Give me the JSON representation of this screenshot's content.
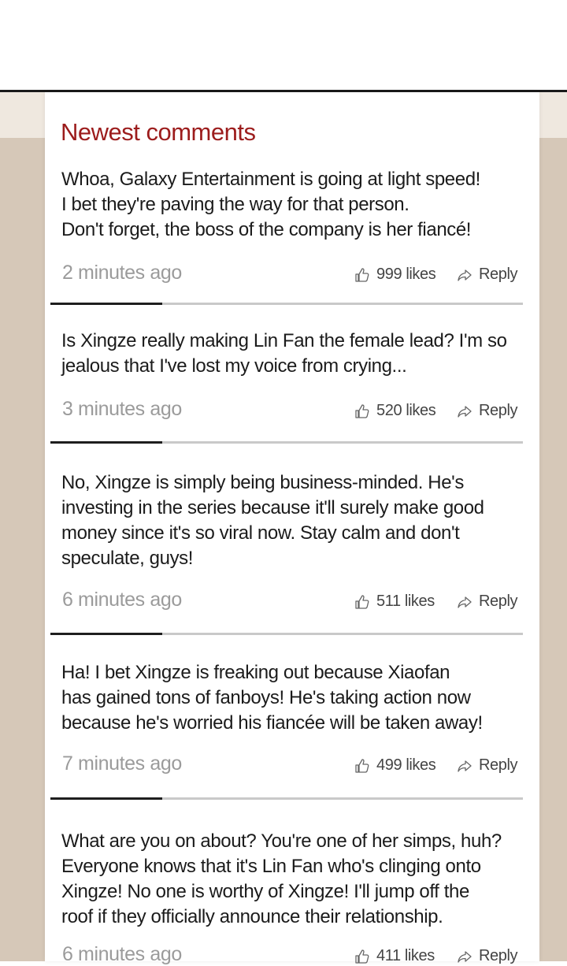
{
  "heading": "Newest comments",
  "colors": {
    "heading": "#9c1c1c",
    "background_band": "#d6c8b8"
  },
  "icons": {
    "like": "thumbs-up-icon",
    "reply": "share-arrow-icon"
  },
  "comments": [
    {
      "lines": [
        "Whoa, Galaxy Entertainment is going at light speed!",
        "I bet they're paving the way for that person.",
        "Don't forget, the boss of the company is her fiancé!"
      ],
      "time": "2 minutes ago",
      "likes": "999 likes",
      "reply": "Reply"
    },
    {
      "lines": [
        "Is Xingze really making Lin Fan the female lead? I'm so",
        "jealous that I've lost my voice from crying..."
      ],
      "time": "3 minutes ago",
      "likes": "520 likes",
      "reply": "Reply"
    },
    {
      "lines": [
        "No, Xingze is simply being business-minded. He's",
        "investing in the series because it'll surely make good",
        "money since it's so viral now. Stay calm and don't",
        "speculate, guys!"
      ],
      "time": "6 minutes ago",
      "likes": "511 likes",
      "reply": "Reply"
    },
    {
      "lines": [
        "Ha! I bet Xingze is freaking out because Xiaofan",
        "has gained tons of fanboys! He's taking action now",
        "because he's worried his fiancée will be taken away!"
      ],
      "time": "7 minutes ago",
      "likes": "499 likes",
      "reply": "Reply"
    },
    {
      "lines": [
        "What are you on about? You're one of her simps, huh?",
        "Everyone knows that it's Lin Fan who's clinging onto",
        "Xingze! No one is worthy of Xingze! I'll jump off the",
        "roof if they officially announce their relationship."
      ],
      "time": "6 minutes ago",
      "likes": "411 likes",
      "reply": "Reply"
    }
  ]
}
